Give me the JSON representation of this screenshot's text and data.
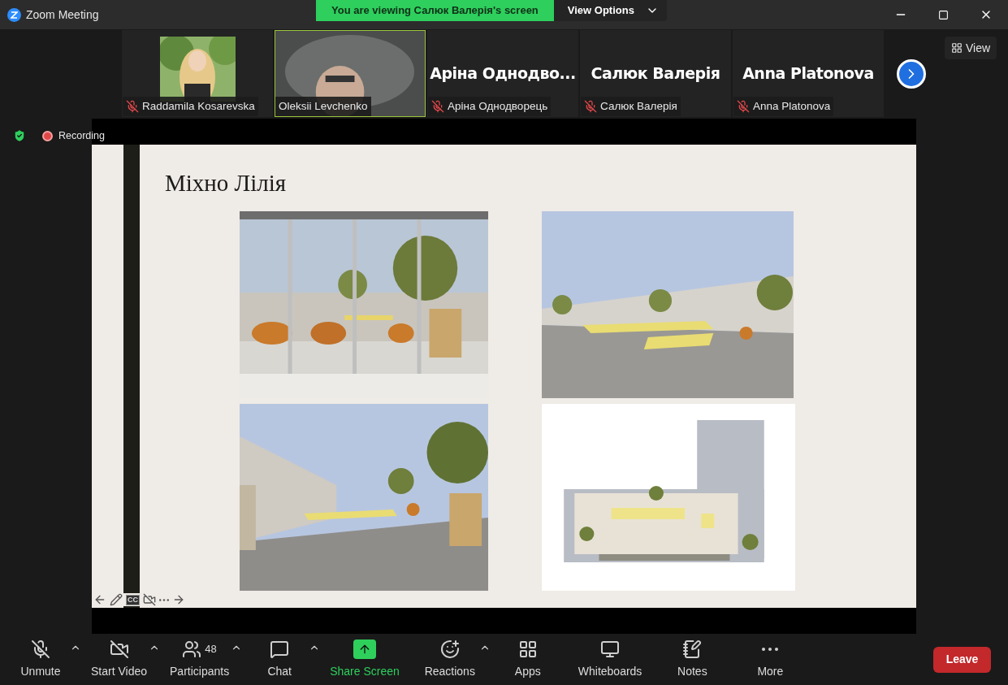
{
  "window": {
    "title": "Zoom Meeting"
  },
  "share_banner": {
    "text": "You are viewing Салюк Валерія's screen",
    "options": "View Options"
  },
  "view_button": {
    "label": "View"
  },
  "participants": [
    {
      "name": "Raddamila Kosarevska",
      "muted": true,
      "speaking": false
    },
    {
      "kind": "video",
      "name": "Oleksii Levchenko",
      "muted": false,
      "speaking": true
    },
    {
      "kind": "name",
      "display": "Аріна Однодво...",
      "name": "Аріна Однодворець",
      "muted": true,
      "speaking": false
    },
    {
      "kind": "name",
      "display": "Салюк Валерія",
      "name": "Салюк Валерія",
      "muted": true,
      "speaking": false
    },
    {
      "kind": "name",
      "display": "Anna Platonova",
      "name": "Anna Platonova",
      "muted": true,
      "speaking": false
    }
  ],
  "recording": {
    "label": "Recording"
  },
  "slide": {
    "title": "Міхно Лілія",
    "controls": [
      {
        "kind": "prev"
      },
      {
        "kind": "pen"
      },
      {
        "kind": "cc",
        "label": "CC"
      },
      {
        "kind": "video-off"
      },
      {
        "kind": "more"
      },
      {
        "kind": "next"
      }
    ]
  },
  "toolbar": [
    {
      "kind": "mic",
      "label": "Unmute",
      "off": true,
      "caret": true
    },
    {
      "kind": "video",
      "label": "Start Video",
      "off": true,
      "caret": true
    },
    {
      "kind": "participants",
      "label": "Participants",
      "count": "48",
      "caret": true
    },
    {
      "kind": "chat",
      "label": "Chat",
      "caret": true
    },
    {
      "kind": "share",
      "label": "Share Screen",
      "caret": false
    },
    {
      "kind": "reactions",
      "label": "Reactions",
      "caret": true
    },
    {
      "kind": "apps",
      "label": "Apps",
      "caret": false
    },
    {
      "kind": "whiteboards",
      "label": "Whiteboards",
      "caret": false
    },
    {
      "kind": "notes",
      "label": "Notes",
      "caret": false
    },
    {
      "kind": "more",
      "label": "More",
      "caret": false
    }
  ],
  "leave": {
    "label": "Leave"
  }
}
